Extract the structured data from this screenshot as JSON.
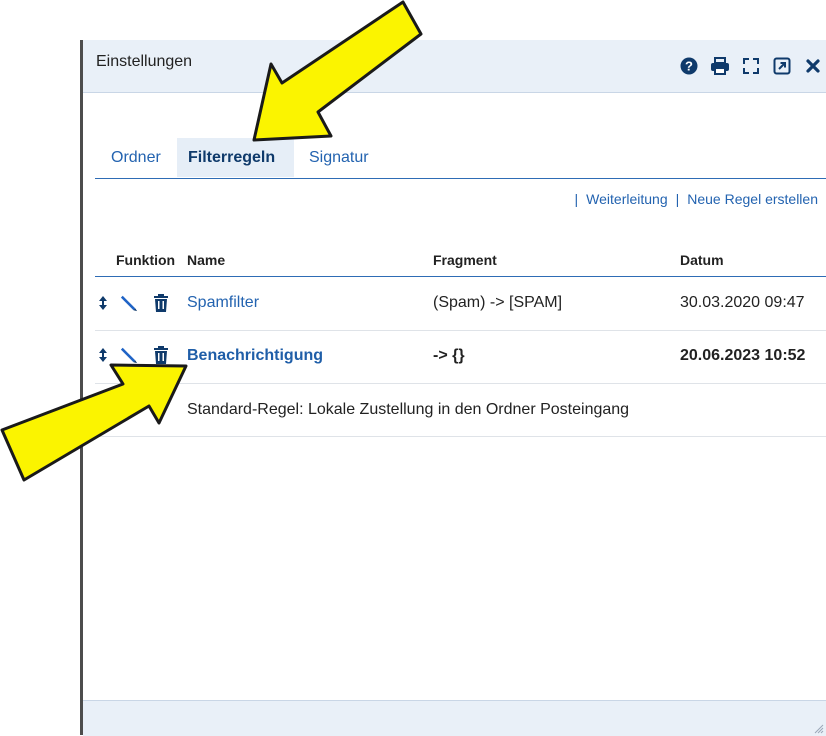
{
  "window": {
    "title": "Einstellungen"
  },
  "header_icons": [
    "help-icon",
    "print-icon",
    "fullscreen-icon",
    "popout-icon",
    "close-icon"
  ],
  "tabs": [
    {
      "label": "Ordner",
      "active": false
    },
    {
      "label": "Filterregeln",
      "active": true
    },
    {
      "label": "Signatur",
      "active": false
    }
  ],
  "links": {
    "forward": "Weiterleitung",
    "new_rule": "Neue Regel erstellen",
    "separator": "|"
  },
  "table": {
    "headers": {
      "function": "Funktion",
      "name": "Name",
      "fragment": "Fragment",
      "date": "Datum"
    },
    "rows": [
      {
        "name": "Spamfilter",
        "fragment": "(Spam) -> [SPAM]",
        "date": "30.03.2020 09:47",
        "bold": false
      },
      {
        "name": "Benachrichtigung",
        "fragment": "-> {}",
        "date": "20.06.2023 10:52",
        "bold": true
      }
    ],
    "default_rule": "Standard-Regel: Lokale Zustellung in den Ordner Posteingang"
  },
  "colors": {
    "accent": "#2363b0",
    "header_bg": "#e9f0f8",
    "arrow_fill": "#fbf400",
    "tab_active_bg": "#e6eef7"
  }
}
